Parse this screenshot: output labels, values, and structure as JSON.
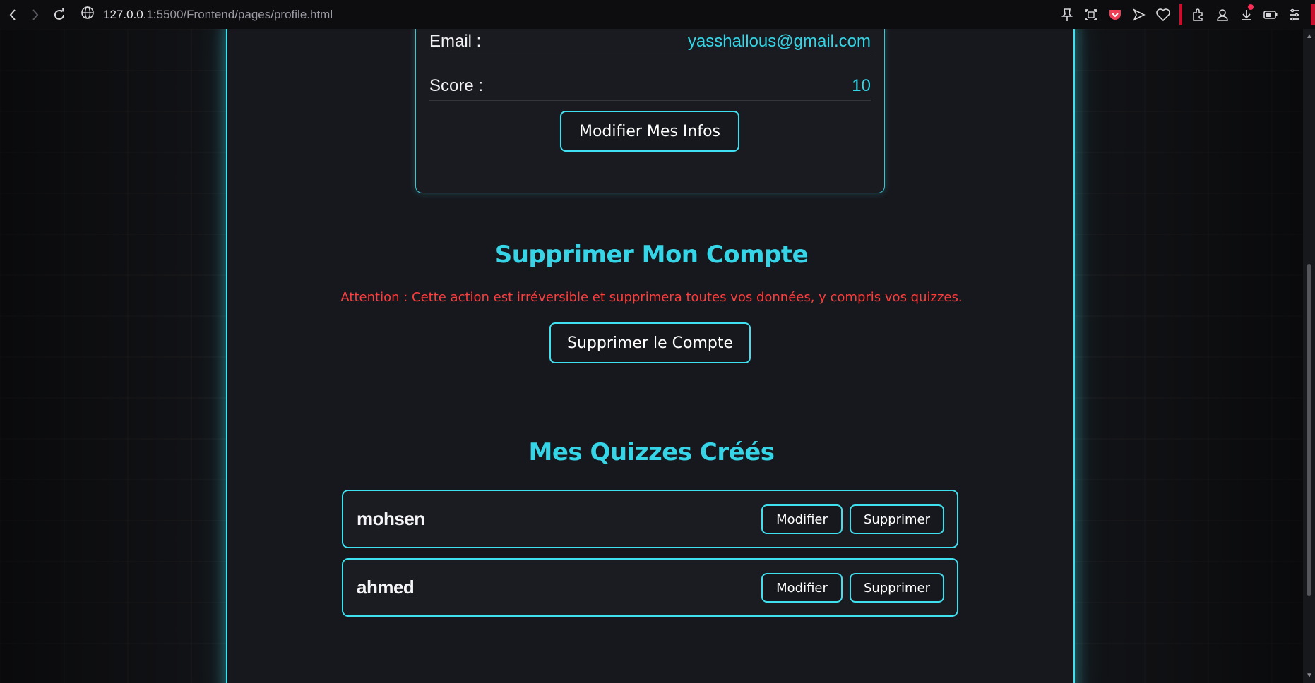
{
  "browser": {
    "url_host": "127.0.0.1:",
    "url_path": "5500/Frontend/pages/profile.html"
  },
  "profile": {
    "email_label": "Email :",
    "email_value": "yasshallous@gmail.com",
    "score_label": "Score :",
    "score_value": "10",
    "edit_button": "Modifier Mes Infos"
  },
  "delete_section": {
    "title": "Supprimer Mon Compte",
    "warning": "Attention : Cette action est irréversible et supprimera toutes vos données, y compris vos quizzes.",
    "button": "Supprimer le Compte"
  },
  "quizzes_section": {
    "title": "Mes Quizzes Créés",
    "items": [
      {
        "name": "mohsen",
        "edit_label": "Modifier",
        "delete_label": "Supprimer"
      },
      {
        "name": "ahmed",
        "edit_label": "Modifier",
        "delete_label": "Supprimer"
      }
    ]
  },
  "colors": {
    "accent": "#3fe0ef",
    "accent_text": "#35d4e6",
    "warning": "#ff3d3d",
    "background": "#15161a"
  }
}
